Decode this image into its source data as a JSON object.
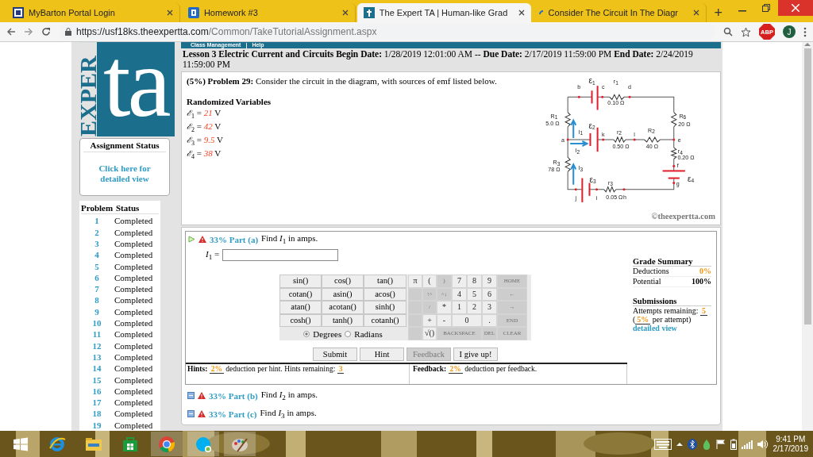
{
  "browser": {
    "tabs": [
      {
        "title": "MyBarton Portal Login",
        "selected": false
      },
      {
        "title": "Homework #3",
        "selected": false
      },
      {
        "title": "The Expert TA | Human-like Grad",
        "selected": true
      },
      {
        "title": "Consider The Circuit In The Diagr",
        "selected": false
      }
    ],
    "new_tab": "+",
    "address": {
      "scheme": "https://",
      "host": "usf18ks.theexpertta.com",
      "path": "/Common/TakeTutorialAssignment.aspx"
    },
    "adblock_label": "ABP",
    "profile_initial": "J"
  },
  "logo": {
    "vertical": "EXPER",
    "letters": "ta"
  },
  "assignment_status": {
    "title": "Assignment Status",
    "link": "Click here for detailed view"
  },
  "status_table": {
    "columns": [
      "Problem",
      "Status"
    ],
    "rows": [
      [
        "1",
        "Completed"
      ],
      [
        "2",
        "Completed"
      ],
      [
        "3",
        "Completed"
      ],
      [
        "4",
        "Completed"
      ],
      [
        "5",
        "Completed"
      ],
      [
        "6",
        "Completed"
      ],
      [
        "7",
        "Completed"
      ],
      [
        "8",
        "Completed"
      ],
      [
        "9",
        "Completed"
      ],
      [
        "10",
        "Completed"
      ],
      [
        "11",
        "Completed"
      ],
      [
        "12",
        "Completed"
      ],
      [
        "13",
        "Completed"
      ],
      [
        "14",
        "Completed"
      ],
      [
        "15",
        "Completed"
      ],
      [
        "16",
        "Completed"
      ],
      [
        "17",
        "Completed"
      ],
      [
        "18",
        "Completed"
      ],
      [
        "19",
        "Completed"
      ]
    ]
  },
  "nav": {
    "items": [
      "Class Management",
      "Help"
    ],
    "separator": "|"
  },
  "lesson_header": "**Lesson 3 Electric Current and Circuits Begin Date:** 1/28/2019 12:01:00 AM -- **Due Date:** 2/17/2019 11:59:00 PM **End Date:** 2/24/2019 11:59:00 PM",
  "problem": {
    "statement": "**(5%)  Problem 29:**  Consider the circuit in the diagram, with sources of emf listed below.",
    "variables_title": "Randomized Variables",
    "variables": [
      {
        "symbol": "ℰ",
        "sub": "1",
        "relation": "=",
        "value": "21",
        "unit": "V"
      },
      {
        "symbol": "ℰ",
        "sub": "2",
        "relation": "=",
        "value": "42",
        "unit": "V"
      },
      {
        "symbol": "ℰ",
        "sub": "3",
        "relation": "=",
        "value": "9.5",
        "unit": "V"
      },
      {
        "symbol": "ℰ",
        "sub": "4",
        "relation": "=",
        "value": "38",
        "unit": "V"
      }
    ],
    "circuit": {
      "labels": [
        {
          "text": "ε",
          "sub": "1"
        },
        {
          "text": "b"
        },
        {
          "text": "c"
        },
        {
          "text": "r",
          "sub": "1"
        },
        {
          "text": "d"
        },
        {
          "text": "0.10 Ω"
        },
        {
          "text": "R",
          "sub": "1"
        },
        {
          "text": "5.0 Ω"
        },
        {
          "text": "R",
          "sub": "6"
        },
        {
          "text": "20 Ω"
        },
        {
          "text": "ε",
          "sub": "2"
        },
        {
          "text": "k"
        },
        {
          "text": "r",
          "sub": "2"
        },
        {
          "text": "l"
        },
        {
          "text": "R",
          "sub": "2"
        },
        {
          "text": "0.50 Ω"
        },
        {
          "text": "40 Ω"
        },
        {
          "text": "a"
        },
        {
          "text": "I",
          "sub": "1"
        },
        {
          "text": "I",
          "sub": "2"
        },
        {
          "text": "e"
        },
        {
          "text": "r",
          "sub": "4"
        },
        {
          "text": "0.20 Ω"
        },
        {
          "text": "f"
        },
        {
          "text": "ε",
          "sub": "4"
        },
        {
          "text": "g"
        },
        {
          "text": "R",
          "sub": "3"
        },
        {
          "text": "78 Ω"
        },
        {
          "text": "I",
          "sub": "3"
        },
        {
          "text": "ε",
          "sub": "3"
        },
        {
          "text": "j"
        },
        {
          "text": "i"
        },
        {
          "text": "r",
          "sub": "3"
        },
        {
          "text": "0.05 Ω"
        },
        {
          "text": "h"
        }
      ]
    },
    "credit": "©theexpertta.com"
  },
  "parts": [
    {
      "percent": "33%",
      "label": "Part (a)",
      "prompt": "Find *I*$_{1}$ in amps.",
      "expanded": true
    },
    {
      "percent": "33%",
      "label": "Part (b)",
      "prompt": "Find *I*$_{2}$ in amps.",
      "expanded": false
    },
    {
      "percent": "33%",
      "label": "Part (c)",
      "prompt": "Find *I*$_{3}$ in amps.",
      "expanded": false
    }
  ],
  "answer": {
    "label": "*I*$_{1}$ ="
  },
  "calculator": {
    "functions": [
      "sin()",
      "cos()",
      "tan()",
      "cotan()",
      "asin()",
      "acos()",
      "atan()",
      "acotan()",
      "sinh()",
      "cosh()",
      "tanh()",
      "cotanh()"
    ],
    "angle_modes": [
      {
        "label": "Degrees",
        "selected": true
      },
      {
        "label": "Radians",
        "selected": false
      }
    ],
    "keys": [
      {
        "label": "π",
        "disabled": false
      },
      {
        "label": "(",
        "disabled": false
      },
      {
        "label": ")",
        "disabled": true
      },
      {
        "label": "7",
        "disabled": false
      },
      {
        "label": "8",
        "disabled": false
      },
      {
        "label": "9",
        "disabled": false
      },
      {
        "label": "HOME",
        "disabled": true
      },
      {
        "disabled": true
      },
      {
        "label": "↑^",
        "disabled": true
      },
      {
        "label": "^↓",
        "disabled": true
      },
      {
        "label": "4",
        "disabled": false
      },
      {
        "label": "5",
        "disabled": false
      },
      {
        "label": "6",
        "disabled": false
      },
      {
        "label": "←",
        "disabled": true
      },
      {
        "disabled": true
      },
      {
        "label": "/",
        "disabled": true
      },
      {
        "label": "*",
        "disabled": false
      },
      {
        "label": "1",
        "disabled": false
      },
      {
        "label": "2",
        "disabled": false
      },
      {
        "label": "3",
        "disabled": false
      },
      {
        "label": "→",
        "disabled": true
      },
      {
        "disabled": true
      },
      {
        "label": "+",
        "disabled": false
      },
      {
        "label": "-",
        "disabled": false
      },
      {
        "label": "0",
        "disabled": false,
        "kind": "double"
      },
      {
        "label": ".",
        "disabled": false
      },
      {
        "label": "END",
        "disabled": true
      },
      {
        "disabled": true
      },
      {
        "label": "√()",
        "disabled": false
      },
      {
        "label": "BACKSPACE",
        "disabled": true,
        "kind": "triple"
      },
      {
        "label": "DEL",
        "disabled": true
      },
      {
        "label": "CLEAR",
        "disabled": true
      }
    ]
  },
  "buttons": [
    {
      "label": "Submit",
      "disabled": false
    },
    {
      "label": "Hint",
      "disabled": false
    },
    {
      "label": "Feedback",
      "disabled": true
    },
    {
      "label": "I give up!",
      "disabled": false
    }
  ],
  "hints": {
    "title": "Hints:",
    "deduction": "2%",
    "text": "deduction per hint. Hints remaining:",
    "remaining": "3"
  },
  "feedback": {
    "title": "Feedback:",
    "deduction": "2%",
    "text": "deduction per feedback."
  },
  "grade_summary": {
    "title": "Grade Summary",
    "rows": [
      {
        "label": "Deductions",
        "value": "0%",
        "highlight": true
      },
      {
        "label": "Potential",
        "value": "100%",
        "highlight": false
      }
    ]
  },
  "submissions": {
    "title": "Submissions",
    "attempts_label": "Attempts remaining:",
    "attempts": "5",
    "per_attempt_before": "(",
    "per_attempt_pct": "5%",
    "per_attempt_after": "per attempt)",
    "link": "detailed view"
  },
  "taskbar": {
    "time": "9:41 PM",
    "date": "2/17/2019"
  }
}
